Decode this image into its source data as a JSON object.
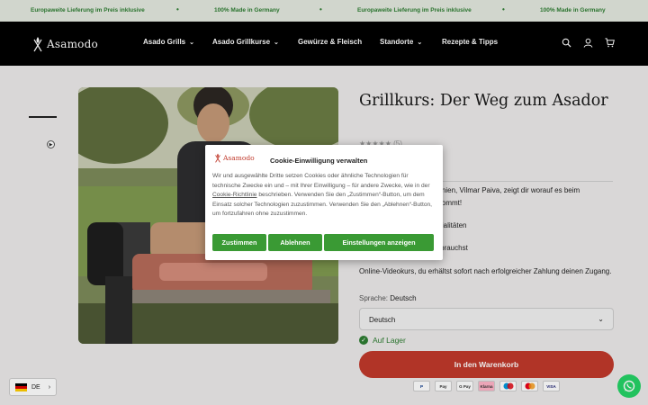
{
  "announcement": {
    "items": [
      "Europaweite Lieferung im Preis inklusive",
      "100% Made in Germany",
      "Europaweite Lieferung im Preis inklusive",
      "100% Made in Germany"
    ]
  },
  "header": {
    "logo_text": "Asamodo",
    "nav": [
      {
        "label": "Asado Grills",
        "has_dropdown": true
      },
      {
        "label": "Asado Grillkurse",
        "has_dropdown": true
      },
      {
        "label": "Gewürze & Fleisch",
        "has_dropdown": false
      },
      {
        "label": "Standorte",
        "has_dropdown": true
      },
      {
        "label": "Rezepte & Tipps",
        "has_dropdown": false
      }
    ],
    "icons": [
      "search-icon",
      "account-icon",
      "cart-icon"
    ]
  },
  "product": {
    "title": "Grillkurs: Der Weg zum Asador",
    "rating_count": "(5)",
    "description_lines": [
      "entinien, Vilmar Paiva, zeigt dir worauf es beim",
      "ankommt!",
      "s",
      "pezialitäten",
      "do brauchst"
    ],
    "video_text": "Online-Videokurs, du erhältst sofort nach erfolgreicher Zahlung deinen Zugang.",
    "language_label": "Sprache:",
    "language_value": "Deutsch",
    "select_value": "Deutsch",
    "stock": "Auf Lager",
    "cart_button": "In den Warenkorb",
    "payments": [
      "PayPal",
      "Apple Pay",
      "G Pay",
      "Klarna",
      "Maestro",
      "Mastercard",
      "VISA"
    ]
  },
  "locale_switch": {
    "code": "DE"
  },
  "cookie": {
    "logo_text": "Asamodo",
    "title": "Cookie-Einwilligung verwalten",
    "text_before_link": "Wir und ausgewählte Dritte setzen Cookies oder ähnliche Technologien für technische Zwecke ein und – mit Ihrer Einwilligung – für andere Zwecke, wie in der ",
    "link": "Cookie-Richtlinie",
    "text_after_link": " beschrieben. Verwenden Sie den „Zustimmen“-Button, um dem Einsatz solcher Technologien zuzustimmen. Verwenden Sie den „Ablehnen“-Button, um fortzufahren ohne zuzustimmen.",
    "accept": "Zustimmen",
    "reject": "Ablehnen",
    "settings": "Einstellungen anzeigen"
  },
  "colors": {
    "accent_green": "#3a9a34",
    "cart_red": "#c0392b",
    "header_bg": "#000000",
    "announcement_bg": "#e3e9df"
  }
}
